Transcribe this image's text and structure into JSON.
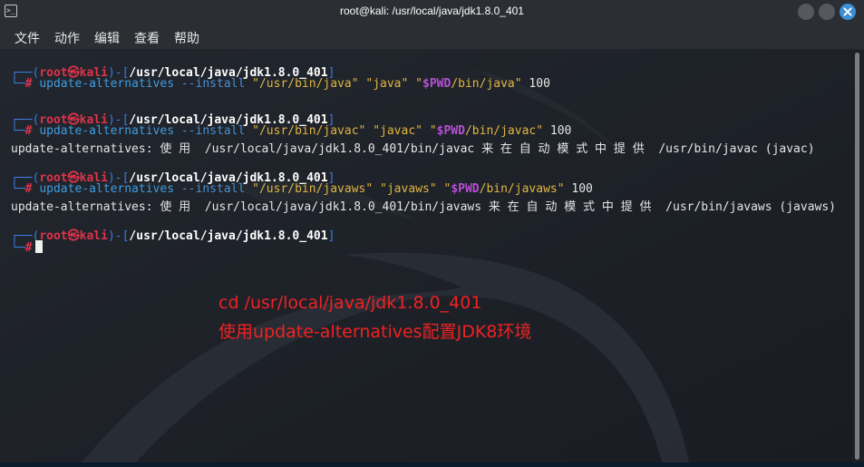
{
  "window": {
    "title": "root@kali: /usr/local/java/jdk1.8.0_401"
  },
  "menu": {
    "file": "文件",
    "action": "动作",
    "edit": "编辑",
    "view": "查看",
    "help": "帮助"
  },
  "prompt": {
    "open": "┌──(",
    "user": "root㉿kali",
    "mid": ")-[",
    "path": "/usr/local/java/jdk1.8.0_401",
    "close": "]",
    "second": "└─",
    "hash": "#"
  },
  "commands": [
    {
      "cmd": "update-alternatives",
      "opt": "--install",
      "arg1": "\"/usr/bin/java\"",
      "arg2": "\"java\"",
      "arg3_q": "\"",
      "arg3_var": "$PWD",
      "arg3_rest": "/bin/java\"",
      "priority": "100",
      "output": ""
    },
    {
      "cmd": "update-alternatives",
      "opt": "--install",
      "arg1": "\"/usr/bin/javac\"",
      "arg2": "\"javac\"",
      "arg3_q": "\"",
      "arg3_var": "$PWD",
      "arg3_rest": "/bin/javac\"",
      "priority": "100",
      "output": "update-alternatives: 使 用  /usr/local/java/jdk1.8.0_401/bin/javac 来 在 自 动 模 式 中 提 供  /usr/bin/javac (javac)"
    },
    {
      "cmd": "update-alternatives",
      "opt": "--install",
      "arg1": "\"/usr/bin/javaws\"",
      "arg2": "\"javaws\"",
      "arg3_q": "\"",
      "arg3_var": "$PWD",
      "arg3_rest": "/bin/javaws\"",
      "priority": "100",
      "output": "update-alternatives: 使 用  /usr/local/java/jdk1.8.0_401/bin/javaws 来 在 自 动 模 式 中 提 供  /usr/bin/javaws (javaws)"
    }
  ],
  "annotation": {
    "line1": "cd /usr/local/java/jdk1.8.0_401",
    "line2": "使用update-alternatives配置JDK8环境"
  },
  "colors": {
    "prompt_blue": "#3c7be0",
    "user_red": "#e0334a",
    "string_yellow": "#e0b640",
    "var_purple": "#b64fd3",
    "annotation_red": "#ee2222",
    "close_button_blue": "#3a8fd6"
  }
}
